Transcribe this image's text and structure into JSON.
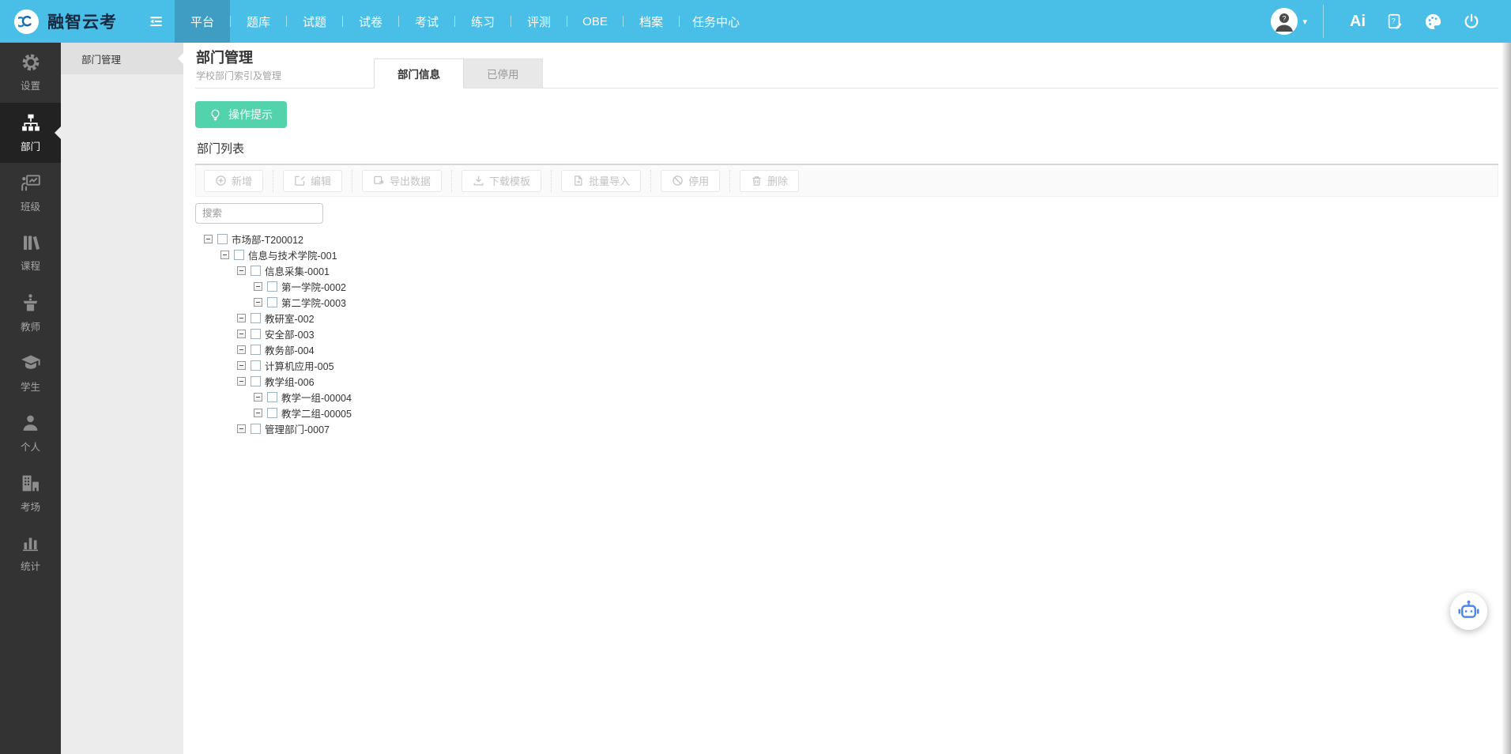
{
  "topbar": {
    "brand": "融智云考",
    "nav": [
      {
        "label": "平台",
        "active": true
      },
      {
        "label": "题库"
      },
      {
        "label": "试题"
      },
      {
        "label": "试卷"
      },
      {
        "label": "考试"
      },
      {
        "label": "练习"
      },
      {
        "label": "评测"
      },
      {
        "label": "OBE"
      },
      {
        "label": "档案"
      },
      {
        "label": "任务中心"
      }
    ],
    "right": {
      "ai_label": "Ai"
    }
  },
  "sidebar": {
    "items": [
      {
        "label": "设置",
        "icon": "gear-icon"
      },
      {
        "label": "部门",
        "icon": "org-tree-icon",
        "active": true
      },
      {
        "label": "班级",
        "icon": "class-board-icon"
      },
      {
        "label": "课程",
        "icon": "books-icon"
      },
      {
        "label": "教师",
        "icon": "teacher-icon"
      },
      {
        "label": "学生",
        "icon": "graduation-cap-icon"
      },
      {
        "label": "个人",
        "icon": "person-icon"
      },
      {
        "label": "考场",
        "icon": "building-icon"
      },
      {
        "label": "统计",
        "icon": "bar-chart-icon"
      }
    ]
  },
  "submenu": {
    "items": [
      {
        "label": "部门管理",
        "active": true
      }
    ]
  },
  "page": {
    "title": "部门管理",
    "subtitle": "学校部门索引及管理",
    "tabs": [
      {
        "label": "部门信息",
        "active": true
      },
      {
        "label": "已停用",
        "active": false
      }
    ],
    "tip_button": "操作提示",
    "section_title": "部门列表",
    "toolbar": [
      {
        "label": "新增",
        "icon": "plus-circle-icon"
      },
      {
        "label": "编辑",
        "icon": "edit-icon"
      },
      {
        "label": "导出数据",
        "icon": "export-icon"
      },
      {
        "label": "下载模板",
        "icon": "download-icon"
      },
      {
        "label": "批量导入",
        "icon": "import-file-icon"
      },
      {
        "label": "停用",
        "icon": "ban-icon"
      },
      {
        "label": "删除",
        "icon": "trash-icon"
      }
    ],
    "search_placeholder": "搜索",
    "tree": [
      {
        "label": "市场部-T200012",
        "level": 0,
        "expanded": true,
        "checked": false
      },
      {
        "label": "信息与技术学院-001",
        "level": 1,
        "expanded": true,
        "checked": false
      },
      {
        "label": "信息采集-0001",
        "level": 2,
        "expanded": true,
        "checked": false
      },
      {
        "label": "第一学院-0002",
        "level": 3,
        "expanded": true,
        "checked": false
      },
      {
        "label": "第二学院-0003",
        "level": 3,
        "expanded": true,
        "checked": false
      },
      {
        "label": "教研室-002",
        "level": 2,
        "expanded": true,
        "checked": false
      },
      {
        "label": "安全部-003",
        "level": 2,
        "expanded": true,
        "checked": false
      },
      {
        "label": "教务部-004",
        "level": 2,
        "expanded": true,
        "checked": false
      },
      {
        "label": "计算机应用-005",
        "level": 2,
        "expanded": true,
        "checked": false
      },
      {
        "label": "教学组-006",
        "level": 2,
        "expanded": true,
        "checked": false
      },
      {
        "label": "教学一组-00004",
        "level": 3,
        "expanded": true,
        "checked": false
      },
      {
        "label": "教学二组-00005",
        "level": 3,
        "expanded": true,
        "checked": false
      },
      {
        "label": "管理部门-0007",
        "level": 2,
        "expanded": true,
        "checked": false
      }
    ]
  },
  "colors": {
    "topbar": "#49bfe7",
    "topbar_active": "#3f9dc3",
    "sidebar": "#333333",
    "sidebar_active": "#222222",
    "submenu_bg": "#ececec",
    "accent_green": "#52d3ab",
    "robot_blue": "#4a87ee",
    "disabled_text": "#c2c2c2"
  }
}
